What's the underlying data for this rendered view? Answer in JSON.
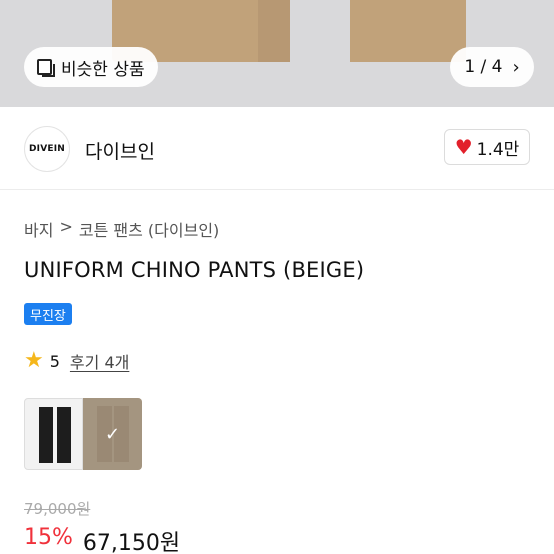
{
  "gallery": {
    "similar_label": "비슷한 상품",
    "pager": "1 / 4",
    "chevron": "›"
  },
  "brand": {
    "logo_text": "DIVEIN",
    "name": "다이브인",
    "likes": "1.4만"
  },
  "breadcrumb": [
    "바지",
    "코튼 팬츠 (다이브인)"
  ],
  "breadcrumb_sep": ">",
  "product": {
    "title": "UNIFORM CHINO PANTS (BEIGE)",
    "badge": "무진장",
    "rating": "5",
    "reviews": "후기 4개",
    "original_price": "79,000원",
    "discount": "15%",
    "price": "67,150원"
  },
  "colors": [
    {
      "name": "black",
      "hex": "#1d1d1d",
      "selected": false
    },
    {
      "name": "beige",
      "hex": "#c9ad88",
      "selected": true
    }
  ],
  "accent": {
    "badge": "#1c7ff0",
    "discount": "#f0313b",
    "heart": "#e2202b",
    "star": "#f5b71c"
  }
}
